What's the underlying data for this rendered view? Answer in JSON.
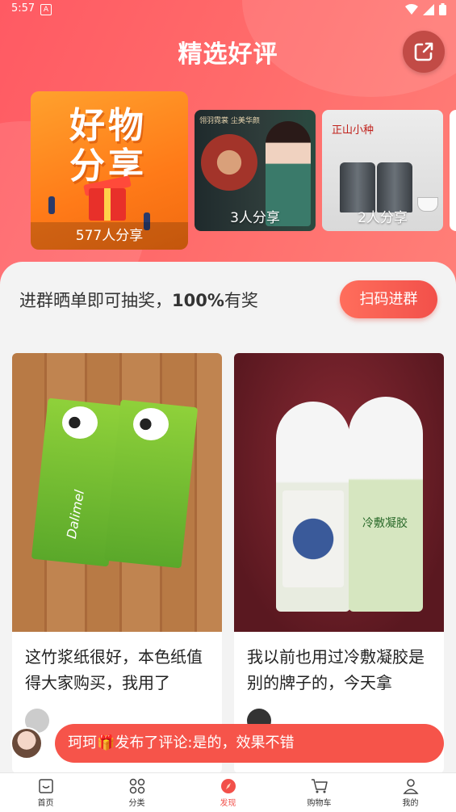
{
  "status": {
    "time": "5:57",
    "app_icon_letter": "A"
  },
  "header": {
    "title": "精选好评"
  },
  "share_cards": [
    {
      "title": "好物\n分享",
      "caption": "577人分享"
    },
    {
      "caption": "3人分享",
      "banner_text": "翎羽霓裳 尘美华颜"
    },
    {
      "caption": "2人分享",
      "banner_text": "正山小种"
    }
  ],
  "promo": {
    "text_prefix": "进群晒单即可抽奖，",
    "text_bold": "100%",
    "text_suffix": "有奖",
    "button": "扫码进群"
  },
  "feed": [
    {
      "text": "这竹浆纸很好，本色纸值得大家购买，我用了",
      "brand": "Dalimel"
    },
    {
      "text": "我以前也用过冷敷凝胶是别的牌子的，今天拿",
      "brand": "冷敷凝胶"
    }
  ],
  "notification": {
    "text": "珂珂🎁发布了评论:是的，效果不错"
  },
  "tabbar": [
    {
      "label": "首页",
      "icon": "home-icon"
    },
    {
      "label": "分类",
      "icon": "category-icon"
    },
    {
      "label": "发现",
      "icon": "compass-icon",
      "active": true
    },
    {
      "label": "购物车",
      "icon": "cart-icon"
    },
    {
      "label": "我的",
      "icon": "profile-icon"
    }
  ],
  "colors": {
    "accent": "#f2504a",
    "header": "#ff6363"
  }
}
